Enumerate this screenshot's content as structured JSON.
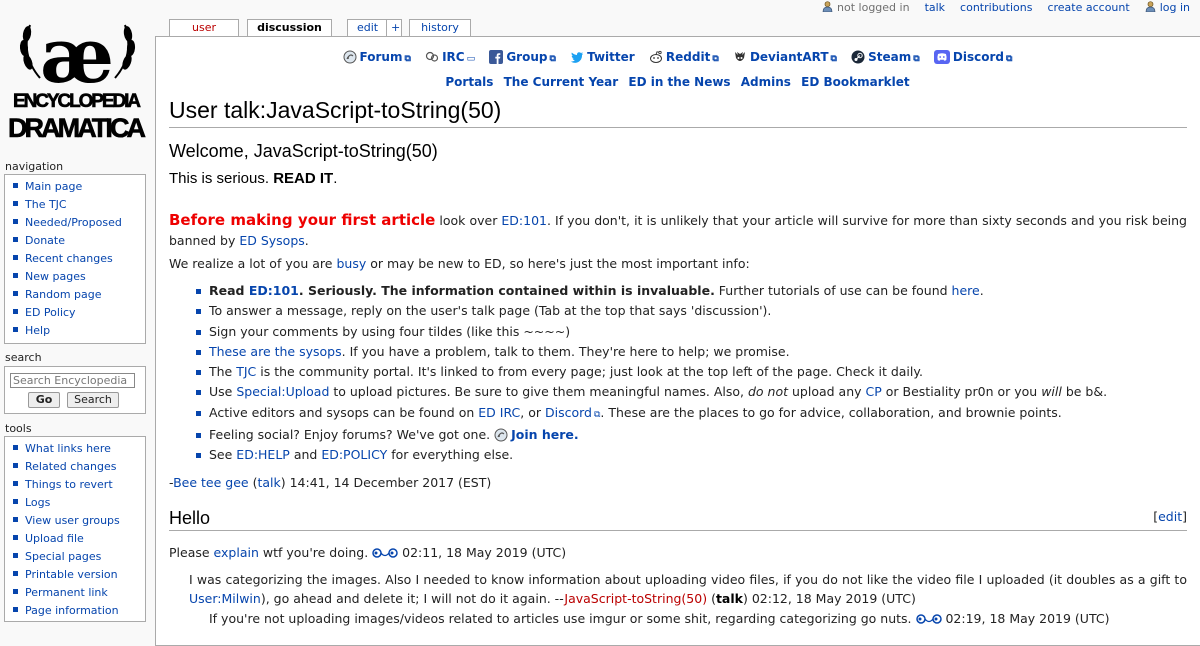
{
  "logo": {
    "line1": "ENCYCLOPEDIA",
    "line2": "DRAMATICA",
    "glyph": "æ"
  },
  "personal_tools": {
    "not_logged_in": "not logged in",
    "talk": "talk",
    "contributions": "contributions",
    "create_account": "create account",
    "log_in": "log in"
  },
  "tabs": {
    "user_page": "user page",
    "discussion": "discussion",
    "edit": "edit",
    "plus": "+",
    "history": "history"
  },
  "sidebar": {
    "navigation_title": "navigation",
    "navigation": [
      "Main page",
      "The TJC",
      "Needed/Proposed",
      "Donate",
      "Recent changes",
      "New pages",
      "Random page",
      "ED Policy",
      "Help"
    ],
    "search_title": "search",
    "search_placeholder": "Search Encyclopedia",
    "go_label": "Go",
    "search_label": "Search",
    "tools_title": "tools",
    "tools": [
      "What links here",
      "Related changes",
      "Things to revert",
      "Logs",
      "View user groups",
      "Upload file",
      "Special pages",
      "Printable version",
      "Permanent link",
      "Page information"
    ]
  },
  "sitenotice": {
    "row1": [
      "Forum",
      "IRC",
      "Group",
      "Twitter",
      "Reddit",
      "DeviantART",
      "Steam",
      "Discord"
    ],
    "row2": [
      "Portals",
      "The Current Year",
      "ED in the News",
      "Admins",
      "ED Bookmarklet"
    ]
  },
  "page": {
    "title": "User talk:JavaScript-toString(50)",
    "welcome": "Welcome, JavaScript-toString(50)",
    "serious_pre": "This is serious. ",
    "serious_bold": "READ IT",
    "serious_post": ".",
    "before_big": "Before making your first article",
    "before_1": " look over ",
    "before_link1": "ED:101",
    "before_2": ". If you don't, it is unlikely that your article will survive for more than sixty seconds and you risk being banned by ",
    "before_link2": "ED Sysops",
    "before_3": ".",
    "realize_1": "We realize a lot of you are ",
    "realize_link": "busy",
    "realize_2": " or may be new to ED, so here's just the most important info:",
    "tips": {
      "t1_a": "Read ",
      "t1_link": "ED:101",
      "t1_b": ". Seriously. The information contained within is invaluable.",
      "t1_c": " Further tutorials of use can be found ",
      "t1_link2": "here",
      "t1_d": ".",
      "t2": "To answer a message, reply on the user's talk page (Tab at the top that says 'discussion').",
      "t3": "Sign your comments by using four tildes (like this ~~~~)",
      "t4_link": "These are the sysops",
      "t4": ". If you have a problem, talk to them. They're here to help; we promise.",
      "t5_a": "The ",
      "t5_link": "TJC",
      "t5_b": " is the community portal. It's linked to from every page; just look at the top left of the page. Check it daily.",
      "t6_a": "Use ",
      "t6_link": "Special:Upload",
      "t6_b": " to upload pictures. Be sure to give them meaningful names. Also, ",
      "t6_em": "do not",
      "t6_c": " upload any ",
      "t6_link2": "CP",
      "t6_d": " or Bestiality pr0n or you ",
      "t6_em2": "will",
      "t6_e": " be b&.",
      "t7_a": "Active editors and sysops can be found on ",
      "t7_link": "ED IRC",
      "t7_b": ", or ",
      "t7_link2": "Discord",
      "t7_c": ". These are the places to go for advice, collaboration, and brownie points.",
      "t8_a": "Feeling social? Enjoy forums? We've got one. ",
      "t8_link": "Join here.",
      "t9_a": "See ",
      "t9_link": "ED:HELP",
      "t9_b": " and ",
      "t9_link2": "ED:POLICY",
      "t9_c": " for everything else."
    },
    "sig1_pre": "-",
    "sig1_user": "Bee tee gee",
    "sig1_talk": "talk",
    "sig1_time": " 14:41, 14 December 2017 (EST)",
    "section_hello": "Hello",
    "edit_label": "edit",
    "c1_pre": "Please ",
    "c1_link": "explain",
    "c1_mid": " wtf you're doing. ",
    "c1_time": " 02:11, 18 May 2019 (UTC)",
    "c2_a": "I was categorizing the images. Also I needed to know information about uploading video files, if you do not like the video file I uploaded (it doubles as a gift to ",
    "c2_link": "User:Milwin",
    "c2_b": "), go ahead and delete it; I will not do it again. --",
    "c2_user": "JavaScript-toString(50)",
    "c2_talk": "talk",
    "c2_time": " 02:12, 18 May 2019 (UTC)",
    "c3": "If you're not uploading images/videos related to articles use imgur or some shit, regarding categorizing go nuts. ",
    "c3_time": " 02:19, 18 May 2019 (UTC)"
  }
}
